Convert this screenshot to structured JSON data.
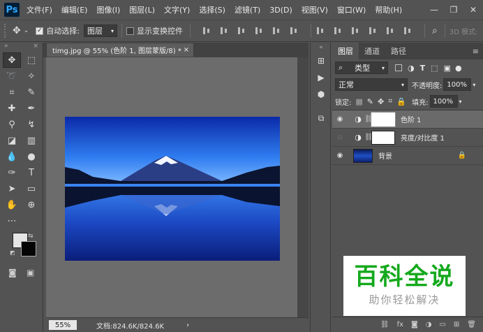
{
  "app": {
    "logo": "Ps"
  },
  "menu": [
    "文件(F)",
    "编辑(E)",
    "图像(I)",
    "图层(L)",
    "文字(Y)",
    "选择(S)",
    "滤镜(T)",
    "3D(D)",
    "视图(V)",
    "窗口(W)",
    "帮助(H)"
  ],
  "window_controls": {
    "minimize": "—",
    "restore": "❐",
    "close": "✕"
  },
  "options": {
    "auto_select_label": "自动选择:",
    "auto_select_target": "图层",
    "show_transform_label": "显示变换控件",
    "mode_3d_label": "3D 模式:"
  },
  "document": {
    "tab_title": "timg.jpg @ 55% (色阶 1, 图层蒙版/8) *",
    "tab_close": "×",
    "zoom": "55%",
    "doc_size": "文档:824.6K/824.6K"
  },
  "layers_panel": {
    "tabs": [
      "图层",
      "通道",
      "路径"
    ],
    "filter_label": "类型",
    "blend_mode": "正常",
    "opacity_label": "不透明度:",
    "opacity_value": "100%",
    "lock_label": "锁定:",
    "fill_label": "填充:",
    "fill_value": "100%",
    "layers": [
      {
        "name": "色阶 1",
        "visible": true,
        "selected": true
      },
      {
        "name": "亮度/对比度 1",
        "visible": false,
        "selected": false
      },
      {
        "name": "背景",
        "visible": true,
        "selected": false,
        "locked": true
      }
    ]
  },
  "watermark": {
    "title": "百科全说",
    "subtitle": "助你轻松解决"
  }
}
